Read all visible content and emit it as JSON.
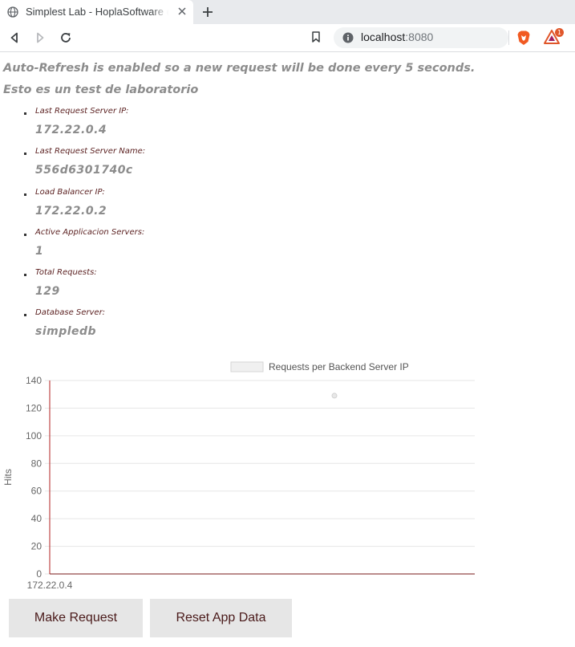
{
  "browser": {
    "tab_title": "Simplest Lab - HoplaSoftware (",
    "url_host": "localhost",
    "url_port": ":8080",
    "rewards_badge": "1",
    "icons": [
      "globe-icon",
      "close-icon",
      "plus-icon",
      "back-icon",
      "forward-icon",
      "reload-icon",
      "bookmark-icon",
      "info-icon",
      "brave-shields-icon",
      "brave-rewards-icon"
    ]
  },
  "page": {
    "auto_refresh_text": "Auto-Refresh is enabled so a new request will be done every 5 seconds.",
    "lab_text": "Esto es un test de laboratorio",
    "items": [
      {
        "label": "Last Request Server IP:",
        "value": "172.22.0.4"
      },
      {
        "label": "Last Request Server Name:",
        "value": "556d6301740c"
      },
      {
        "label": "Load Balancer IP:",
        "value": "172.22.0.2"
      },
      {
        "label": "Active Applicacion Servers:",
        "value": "1"
      },
      {
        "label": "Total Requests:",
        "value": "129"
      },
      {
        "label": "Database Server:",
        "value": "simpledb"
      }
    ],
    "buttons": {
      "make_request": "Make Request",
      "reset": "Reset App Data"
    }
  },
  "chart_data": {
    "type": "scatter",
    "title": "",
    "legend": "Requests per Backend Server IP",
    "legend_position": "top",
    "xlabel": "",
    "ylabel": "Hits",
    "categories": [
      "172.22.0.4"
    ],
    "series": [
      {
        "name": "Requests per Backend Server IP",
        "points": [
          {
            "x": "172.22.0.4",
            "y": 129
          }
        ]
      }
    ],
    "ylim": [
      0,
      140
    ],
    "yticks": [
      0,
      20,
      40,
      60,
      80,
      100,
      120,
      140
    ],
    "grid": true
  }
}
